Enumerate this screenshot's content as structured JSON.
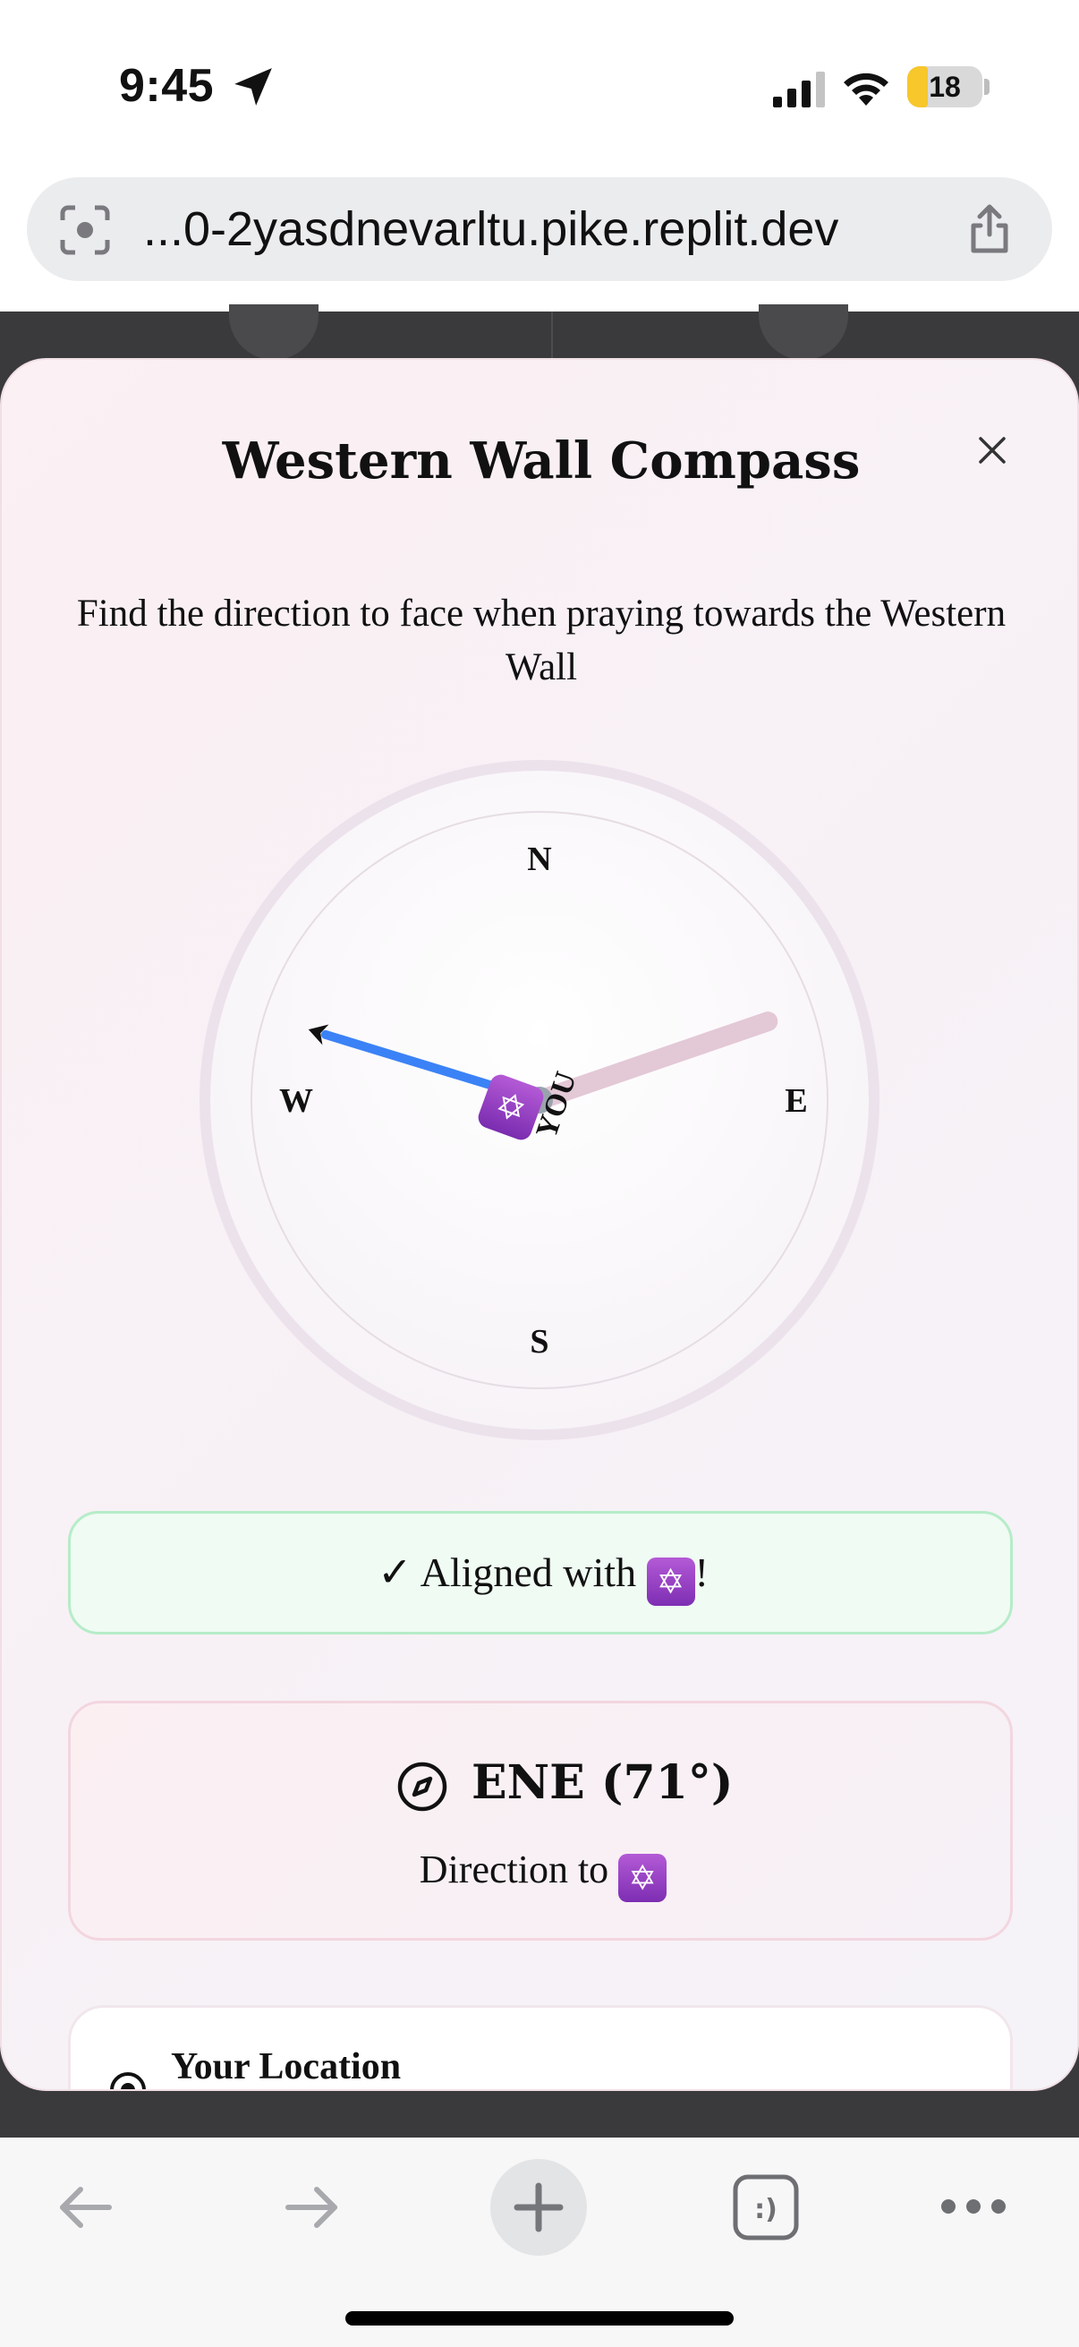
{
  "status_bar": {
    "time": "9:45",
    "battery_level": "18",
    "icons": [
      "location-arrow-icon",
      "cellular-signal-icon",
      "wifi-icon",
      "battery-icon"
    ]
  },
  "browser": {
    "url": "...0-2yasdnevarltu.pike.replit.dev",
    "icons": [
      "lens-icon",
      "share-icon"
    ]
  },
  "modal": {
    "title": "Western Wall Compass",
    "description": "Find the direction to face when praying towards the Western Wall",
    "compass": {
      "labels": {
        "north": "N",
        "east": "E",
        "south": "S",
        "west": "W"
      },
      "you_label": "YOU",
      "target_bearing_deg": 71,
      "device_heading_deg": 287,
      "target_icon": "star-of-david-icon",
      "target_glyph": "✡"
    },
    "aligned": {
      "prefix": "✓ Aligned with ",
      "suffix": "!",
      "glyph": "✡",
      "accent": "#b6ecc8"
    },
    "direction": {
      "value": "ENE (71°)",
      "label": "Direction to ",
      "glyph": "✡"
    },
    "location": {
      "title": "Your Location"
    }
  },
  "toolbar": {
    "icons": [
      "back-arrow-icon",
      "forward-arrow-icon",
      "new-tab-plus-icon",
      "tabs-icon",
      "more-dots-icon"
    ]
  },
  "colors": {
    "needle_blue": "#3b82f6",
    "target_needle": "#e3c8d6",
    "badge_purple": "#9a44c8",
    "aligned_bg": "#effbf3"
  }
}
